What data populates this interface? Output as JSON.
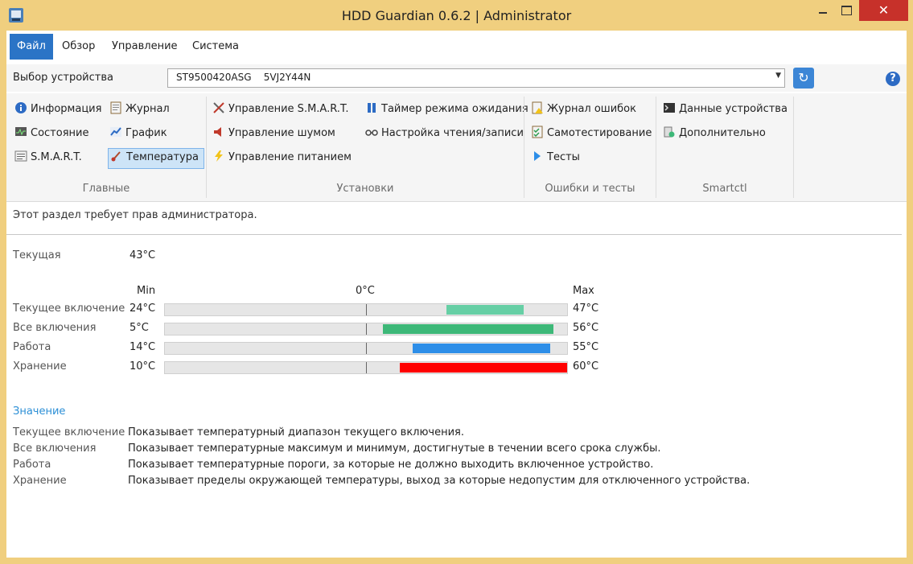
{
  "window": {
    "title": "HDD Guardian 0.6.2 | Administrator",
    "minimize_glyph": "",
    "close_glyph": "✕"
  },
  "menu": [
    "Файл",
    "Обзор",
    "Управление",
    "Система"
  ],
  "device": {
    "label": "Выбор устройства",
    "selected": "ST9500420ASG    5VJ2Y44N",
    "refresh_glyph": "↻",
    "help_glyph": "?"
  },
  "ribbon": {
    "groups": [
      "Главные",
      "Установки",
      "Ошибки и тесты",
      "Smartctl"
    ],
    "main": [
      "Информация",
      "Журнал",
      "Состояние",
      "График",
      "S.M.A.R.T.",
      "Температура"
    ],
    "settings": [
      "Управление S.M.A.R.T.",
      "Таймер режима ожидания",
      "Управление шумом",
      "Настройка чтения/записи",
      "Управление питанием"
    ],
    "errors": [
      "Журнал ошибок",
      "Самотестирование",
      "Тесты"
    ],
    "smartctl": [
      "Данные устройства",
      "Дополнительно"
    ],
    "icons": [
      "info-icon",
      "log-icon",
      "status-icon",
      "graph-icon",
      "smart-icon",
      "thermometer-icon",
      "tools-icon",
      "pause-icon",
      "speaker-icon",
      "glasses-icon",
      "lightning-icon",
      "error-log-icon",
      "checklist-icon",
      "play-icon",
      "terminal-icon",
      "gear-icon"
    ]
  },
  "notice": "Этот раздел требует прав администратора.",
  "current": {
    "label": "Текущая",
    "value": "43°C"
  },
  "scale": {
    "min_label": "Min",
    "zero_label": "0°C",
    "max_label": "Max",
    "range_c": [
      -60,
      60
    ]
  },
  "rows": [
    {
      "label": "Текущее включение",
      "min_text": "24°C",
      "max_text": "47°C",
      "min": 24,
      "max": 47,
      "color": "#66cfa5"
    },
    {
      "label": "Все включения",
      "min_text": "5°C",
      "max_text": "56°C",
      "min": 5,
      "max": 56,
      "color": "#3db878"
    },
    {
      "label": "Работа",
      "min_text": "14°C",
      "max_text": "55°C",
      "min": 14,
      "max": 55,
      "color": "#2d8ee8"
    },
    {
      "label": "Хранение",
      "min_text": "10°C",
      "max_text": "60°C",
      "min": 10,
      "max": 60,
      "color": "#ff0000"
    }
  ],
  "meaning": {
    "title": "Значение",
    "items": [
      {
        "label": "Текущее включение",
        "text": "Показывает температурный диапазон текущего включения."
      },
      {
        "label": "Все включения",
        "text": "Показывает температурные максимум и минимум, достигнутые в течении всего срока службы."
      },
      {
        "label": "Работа",
        "text": "Показывает температурные пороги, за которые не должно выходить включенное устройство."
      },
      {
        "label": "Хранение",
        "text": "Показывает пределы окружающей температуры, выход за которые недопустим для отключенного устройства."
      }
    ]
  }
}
